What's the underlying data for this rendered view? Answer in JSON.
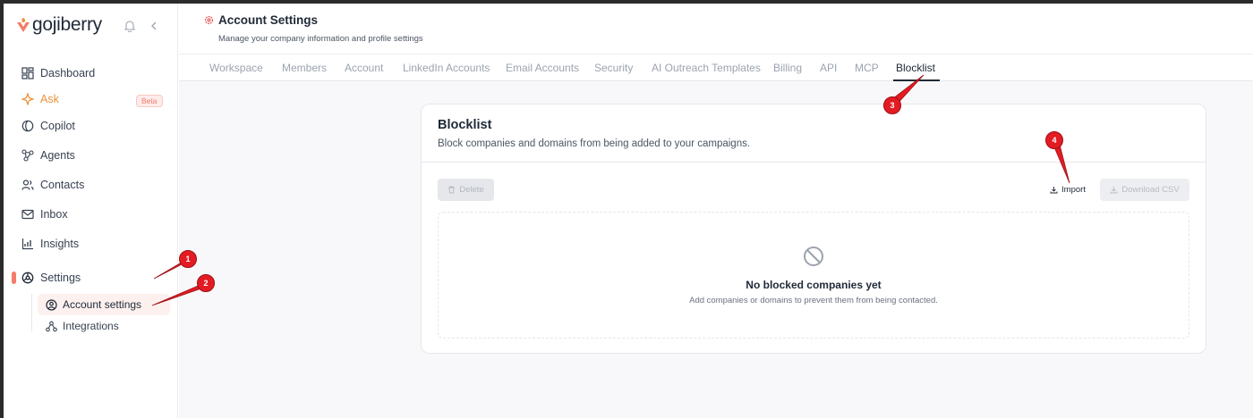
{
  "app": {
    "logo_text": "gojiberry"
  },
  "sidebar": {
    "items": [
      {
        "label": "Dashboard",
        "icon": "dashboard-icon"
      },
      {
        "label": "Ask",
        "icon": "sparkle-icon",
        "badge": "Beta"
      },
      {
        "label": "Copilot",
        "icon": "copilot-icon"
      },
      {
        "label": "Agents",
        "icon": "agents-icon"
      },
      {
        "label": "Contacts",
        "icon": "contacts-icon"
      },
      {
        "label": "Inbox",
        "icon": "inbox-icon"
      },
      {
        "label": "Insights",
        "icon": "insights-icon"
      },
      {
        "label": "Settings",
        "icon": "settings-icon"
      }
    ],
    "sub_items": [
      {
        "label": "Account settings",
        "icon": "user-circle-icon",
        "active": true
      },
      {
        "label": "Integrations",
        "icon": "integrations-icon"
      }
    ]
  },
  "header": {
    "title": "Account Settings",
    "subtitle": "Manage your company information and profile settings"
  },
  "tabs": [
    {
      "label": "Workspace"
    },
    {
      "label": "Members"
    },
    {
      "label": "Account"
    },
    {
      "label": "LinkedIn Accounts"
    },
    {
      "label": "Email Accounts"
    },
    {
      "label": "Security"
    },
    {
      "label": "AI Outreach Templates"
    },
    {
      "label": "Billing"
    },
    {
      "label": "API"
    },
    {
      "label": "MCP"
    },
    {
      "label": "Blocklist",
      "active": true
    }
  ],
  "card": {
    "title": "Blocklist",
    "description": "Block companies and domains from being added to your campaigns.",
    "delete_label": "Delete",
    "import_label": "Import",
    "download_label": "Download CSV",
    "empty_title": "No blocked companies yet",
    "empty_subtitle": "Add companies or domains to prevent them from being contacted."
  },
  "annotations": [
    "1",
    "2",
    "3",
    "4"
  ],
  "colors": {
    "accent": "#f47c6a",
    "ask": "#e8913a",
    "annotation": "#e31b23"
  }
}
